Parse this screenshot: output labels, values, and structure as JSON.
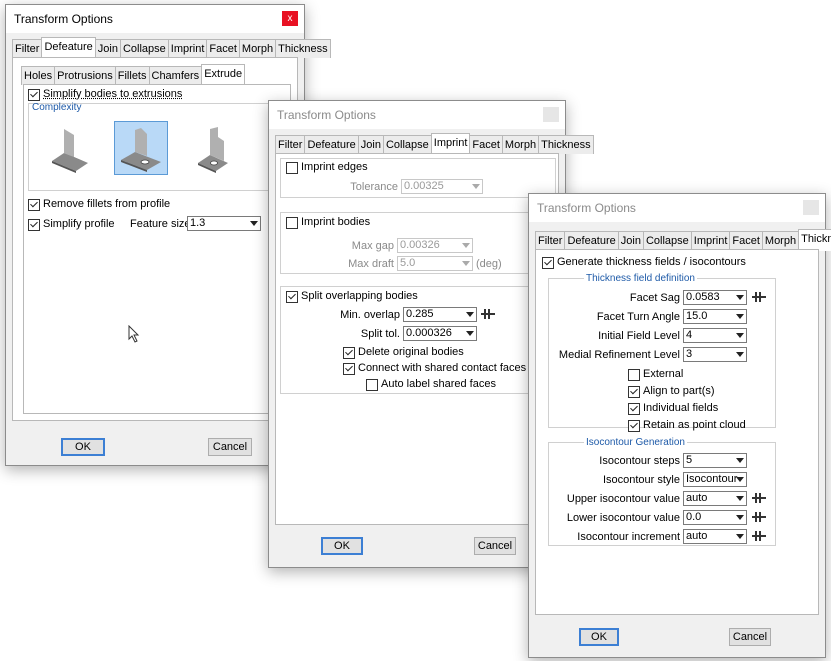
{
  "w1": {
    "title": "Transform Options",
    "close_glyph": "x",
    "tabs": [
      "Filter",
      "Defeature",
      "Join",
      "Collapse",
      "Imprint",
      "Facet",
      "Morph",
      "Thickness"
    ],
    "subtabs": [
      "Holes",
      "Protrusions",
      "Fillets",
      "Chamfers",
      "Extrude"
    ],
    "simplify_label": "Simplify bodies to extrusions",
    "complexity_label": "Complexity",
    "shapes": [
      "shape-simple-icon",
      "shape-medium-icon",
      "shape-complex-icon"
    ],
    "remove_fillets_label": "Remove fillets from profile",
    "simplify_profile_label": "Simplify profile",
    "feature_size_label": "Feature size",
    "feature_size_value": "1.3",
    "ok_label": "OK",
    "cancel_label": "Cancel"
  },
  "w2": {
    "title": "Transform Options",
    "tabs": [
      "Filter",
      "Defeature",
      "Join",
      "Collapse",
      "Imprint",
      "Facet",
      "Morph",
      "Thickness"
    ],
    "imprint_edges_label": "Imprint edges",
    "tolerance_label": "Tolerance",
    "tolerance_value": "0.00325",
    "imprint_bodies_label": "Imprint bodies",
    "max_gap_label": "Max gap",
    "max_gap_value": "0.00326",
    "max_draft_label": "Max draft",
    "max_draft_value": "5.0",
    "deg_label": "(deg)",
    "split_label": "Split overlapping bodies",
    "min_overlap_label": "Min. overlap",
    "min_overlap_value": "0.285",
    "split_tol_label": "Split tol.",
    "split_tol_value": "0.000326",
    "delete_label": "Delete original bodies",
    "connect_label": "Connect with shared contact faces",
    "auto_label": "Auto label shared faces",
    "ok_label": "OK",
    "cancel_label": "Cancel"
  },
  "w3": {
    "title": "Transform Options",
    "tabs": [
      "Filter",
      "Defeature",
      "Join",
      "Collapse",
      "Imprint",
      "Facet",
      "Morph",
      "Thickness"
    ],
    "generate_label": "Generate thickness fields / isocontours",
    "tfd_title": "Thickness field definition",
    "facet_sag_label": "Facet Sag",
    "facet_sag_value": "0.0583",
    "facet_turn_label": "Facet Turn Angle",
    "facet_turn_value": "15.0",
    "initial_level_label": "Initial Field Level",
    "initial_level_value": "4",
    "medial_label": "Medial Refinement Level",
    "medial_value": "3",
    "external_label": "External",
    "align_label": "Align to part(s)",
    "individual_label": "Individual fields",
    "retain_label": "Retain as point cloud",
    "iso_title": "Isocontour Generation",
    "iso_steps_label": "Isocontour steps",
    "iso_steps_value": "5",
    "iso_style_label": "Isocontour style",
    "iso_style_value": "Isocontour",
    "upper_label": "Upper isocontour value",
    "upper_value": "auto",
    "lower_label": "Lower isocontour value",
    "lower_value": "0.0",
    "incr_label": "Isocontour increment",
    "incr_value": "auto",
    "ok_label": "OK",
    "cancel_label": "Cancel"
  }
}
